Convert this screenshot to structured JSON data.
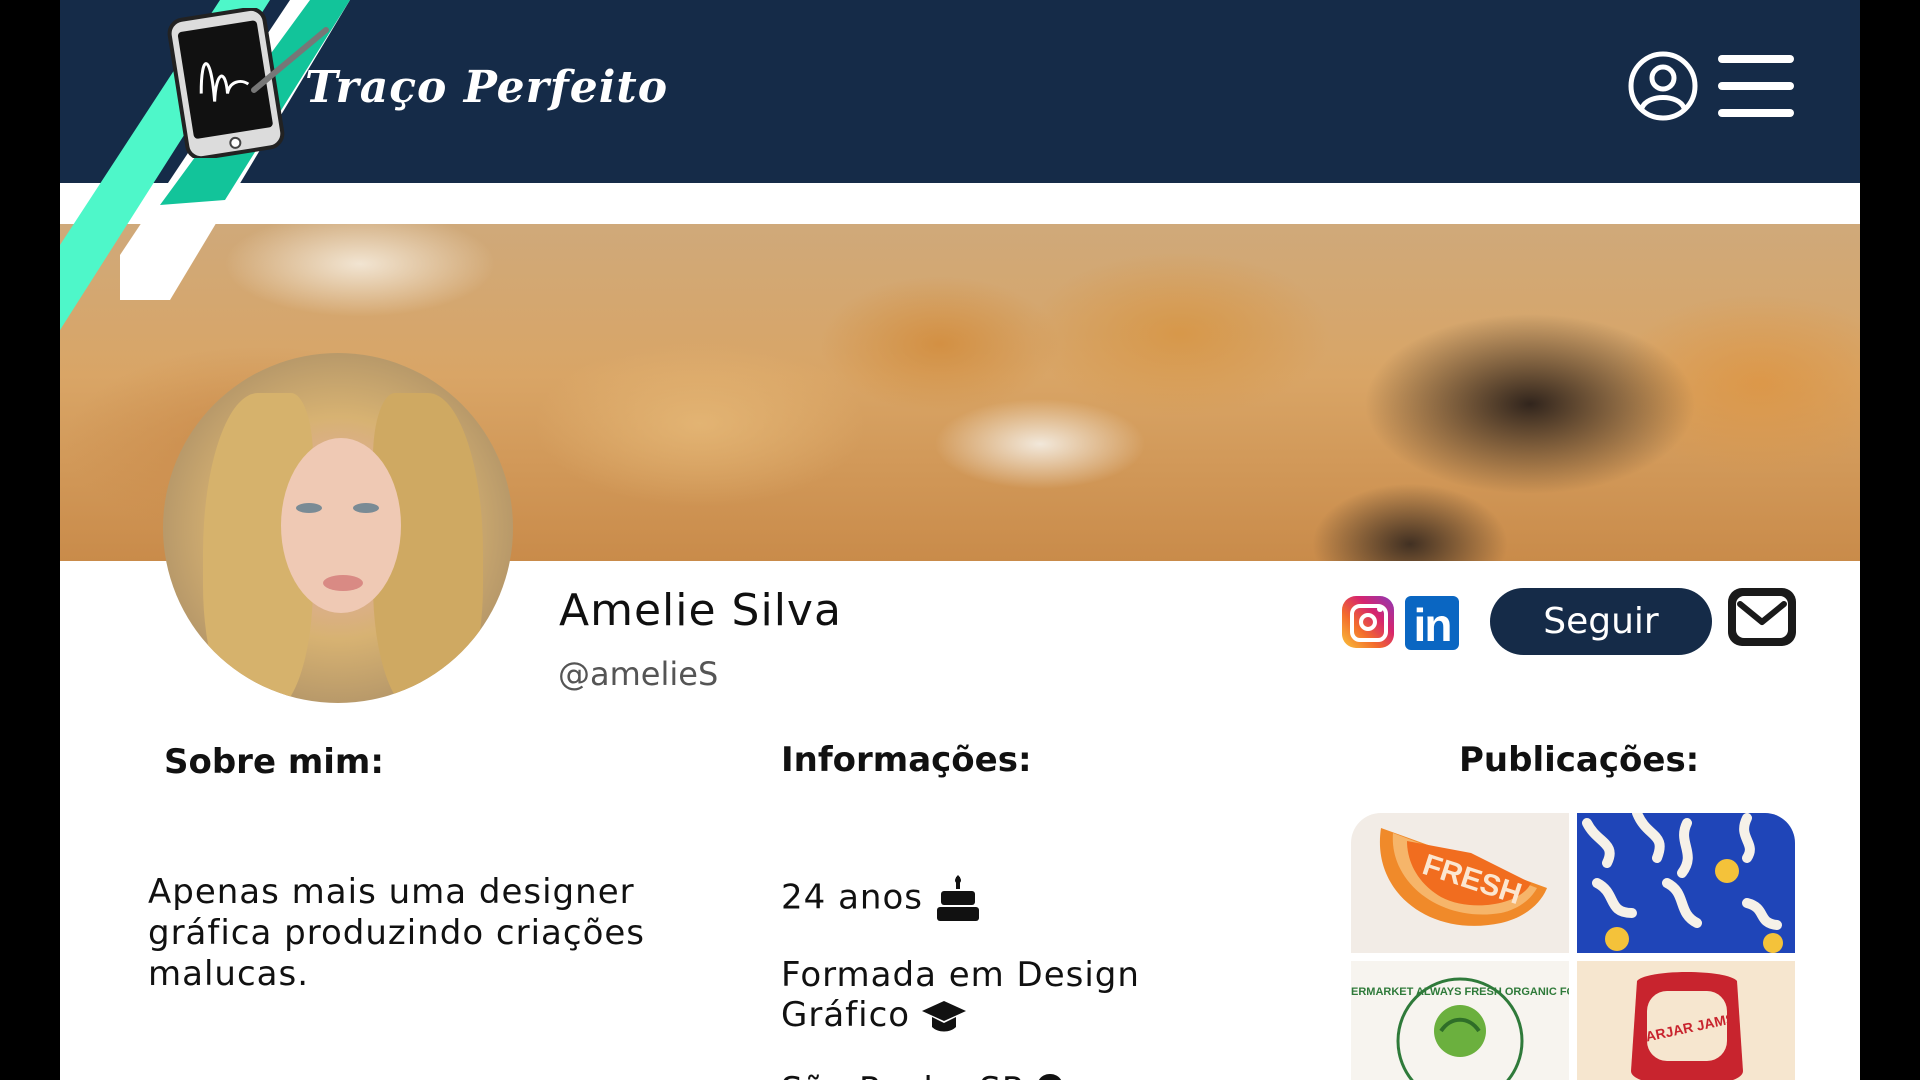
{
  "header": {
    "brand": "Traço Perfeito",
    "colors": {
      "header_bg": "#152b48",
      "stripe_mint": "#4ef7c9",
      "stripe_teal": "#12c49a"
    },
    "icons": [
      "phone-signature-logo-icon",
      "user-icon",
      "menu-icon"
    ]
  },
  "profile": {
    "name": "Amelie Silva",
    "handle": "@amelieS",
    "follow_label": "Seguir",
    "socials": [
      "instagram-icon",
      "linkedin-icon"
    ],
    "linkedin_glyph": "in",
    "mail_icon": "mail-icon"
  },
  "about": {
    "title": "Sobre mim:",
    "text": " Apenas mais uma designer gráfica produzindo criações malucas."
  },
  "info": {
    "title": "Informações:",
    "age": "24 anos",
    "graduation": "Formada em Design Gráfico",
    "city": "São Paulo, SP",
    "icons": [
      "cake-icon",
      "graduation-cap-icon",
      "location-pin-icon"
    ]
  },
  "publications": {
    "title": "Publicações:",
    "tiles": [
      {
        "label": "FRESH"
      },
      {
        "label": ""
      },
      {
        "label": "SUPERMARKET ALWAYS FRESH ORGANIC FOOD"
      },
      {
        "label": "JARJAR JAMS"
      }
    ]
  }
}
